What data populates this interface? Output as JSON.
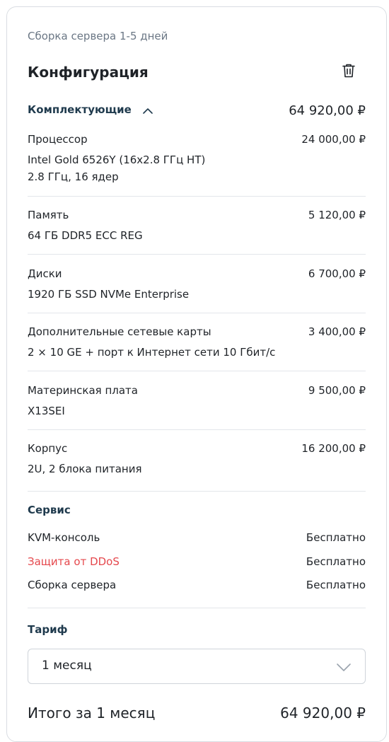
{
  "card": {
    "assembly_note": "Сборка сервера 1-5 дней",
    "title": "Конфигурация",
    "delete_icon": "trash-icon"
  },
  "components": {
    "label": "Комплектующие",
    "toggle_icon": "chevron-up-icon",
    "total": "64 920,00 ₽",
    "items": [
      {
        "label": "Процессор",
        "price": "24 000,00 ₽",
        "value": "Intel Gold 6526Y (16x2.8 ГГц HT)",
        "value2": "2.8 ГГц, 16 ядер"
      },
      {
        "label": "Память",
        "price": "5 120,00 ₽",
        "value": "64 ГБ DDR5 ECC REG"
      },
      {
        "label": "Диски",
        "price": "6 700,00 ₽",
        "value": "1920 ГБ SSD NVMe Enterprise"
      },
      {
        "label": "Дополнительные сетевые карты",
        "price": "3 400,00 ₽",
        "value": "2 × 10 GE + порт к Интернет сети 10 Гбит/с"
      },
      {
        "label": "Материнская плата",
        "price": "9 500,00 ₽",
        "value": "X13SEI"
      },
      {
        "label": "Корпус",
        "price": "16 200,00 ₽",
        "value": "2U, 2 блока питания"
      }
    ]
  },
  "service": {
    "title": "Сервис",
    "items": [
      {
        "label": "KVM-консоль",
        "value": "Бесплатно"
      },
      {
        "label": "Защита от DDoS",
        "value": "Бесплатно",
        "accent": "#e5484d"
      },
      {
        "label": "Сборка сервера",
        "value": "Бесплатно"
      }
    ]
  },
  "tariff": {
    "title": "Тариф",
    "selected": "1 месяц",
    "dropdown_icon": "chevron-down-icon"
  },
  "total": {
    "label": "Итого за 1 месяц",
    "value": "64 920,00 ₽"
  }
}
